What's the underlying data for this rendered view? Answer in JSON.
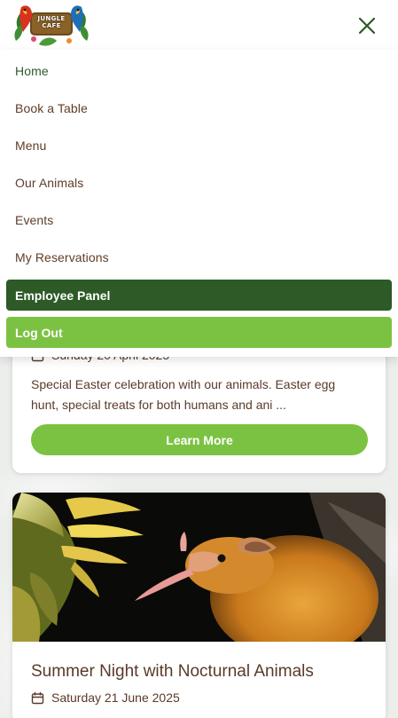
{
  "brand": {
    "logo_text": "JUNGLE CAFE",
    "logo_alt": "jungle-cafe-logo",
    "colors": {
      "dark_green": "#2d5a27",
      "light_green": "#7cc242",
      "brown_text": "#5e3d28"
    }
  },
  "header": {
    "close_icon": "close-x-icon"
  },
  "nav": {
    "items": [
      {
        "label": "Home",
        "active": true
      },
      {
        "label": "Book a Table",
        "active": false
      },
      {
        "label": "Menu",
        "active": false
      },
      {
        "label": "Our Animals",
        "active": false
      },
      {
        "label": "Events",
        "active": false
      },
      {
        "label": "My Reservations",
        "active": false
      }
    ],
    "employee_panel": "Employee Panel",
    "log_out": "Log Out"
  },
  "events": [
    {
      "date": "Sunday 20 April 2025",
      "description": "Special Easter celebration with our animals. Easter egg hunt, special treats for both humans and ani ...",
      "button": "Learn More"
    },
    {
      "image": "nocturnal-bat-photo",
      "title": "Summer Night with Nocturnal Animals",
      "date": "Saturday 21 June 2025"
    }
  ]
}
